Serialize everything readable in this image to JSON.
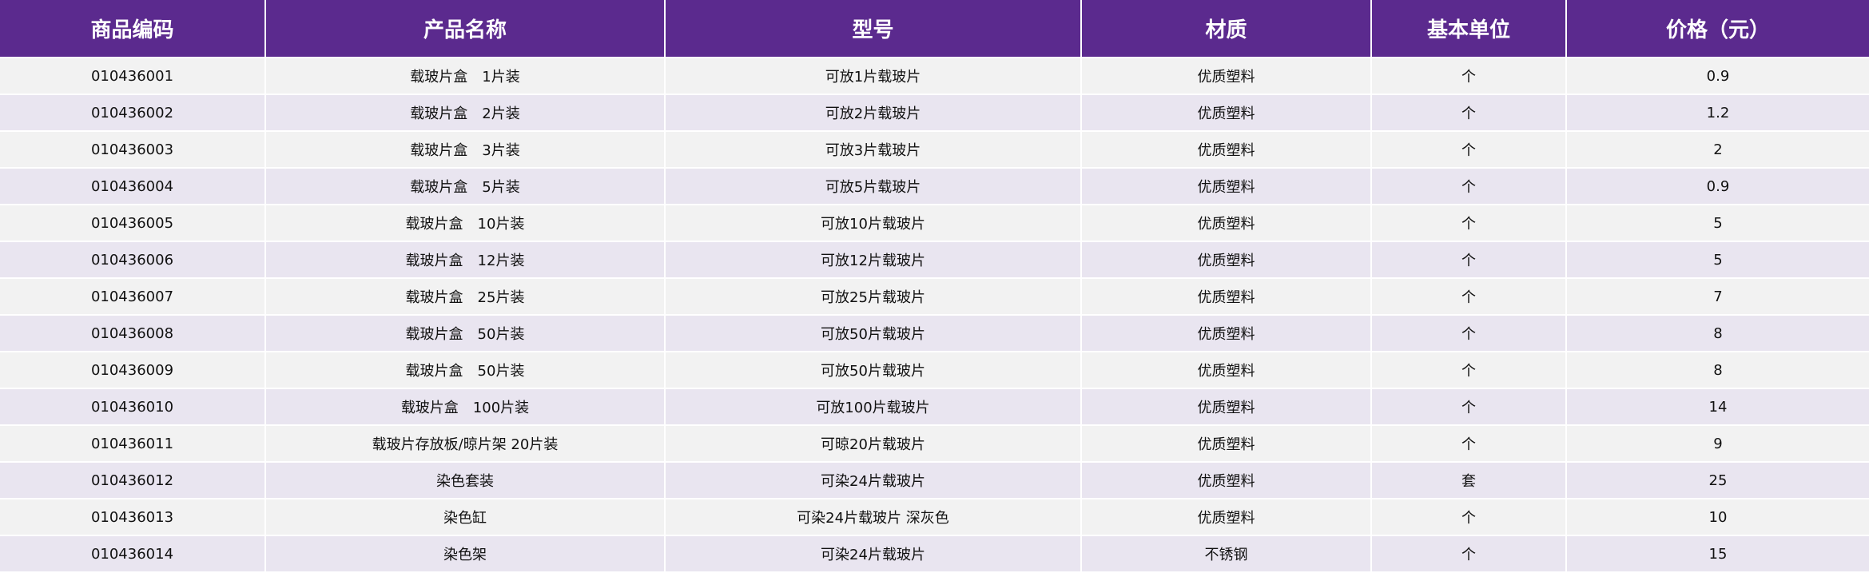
{
  "table": {
    "headers": [
      "商品编码",
      "产品名称",
      "型号",
      "材质",
      "基本单位",
      "价格（元）"
    ],
    "rows": [
      [
        "010436001",
        "载玻片盒　1片装",
        "可放1片载玻片",
        "优质塑料",
        "个",
        "0.9"
      ],
      [
        "010436002",
        "载玻片盒　2片装",
        "可放2片载玻片",
        "优质塑料",
        "个",
        "1.2"
      ],
      [
        "010436003",
        "载玻片盒　3片装",
        "可放3片载玻片",
        "优质塑料",
        "个",
        "2"
      ],
      [
        "010436004",
        "载玻片盒　5片装",
        "可放5片载玻片",
        "优质塑料",
        "个",
        "0.9"
      ],
      [
        "010436005",
        "载玻片盒　10片装",
        "可放10片载玻片",
        "优质塑料",
        "个",
        "5"
      ],
      [
        "010436006",
        "载玻片盒　12片装",
        "可放12片载玻片",
        "优质塑料",
        "个",
        "5"
      ],
      [
        "010436007",
        "载玻片盒　25片装",
        "可放25片载玻片",
        "优质塑料",
        "个",
        "7"
      ],
      [
        "010436008",
        "载玻片盒　50片装",
        "可放50片载玻片",
        "优质塑料",
        "个",
        "8"
      ],
      [
        "010436009",
        "载玻片盒　50片装",
        "可放50片载玻片",
        "优质塑料",
        "个",
        "8"
      ],
      [
        "010436010",
        "载玻片盒　100片装",
        "可放100片载玻片",
        "优质塑料",
        "个",
        "14"
      ],
      [
        "010436011",
        "载玻片存放板/晾片架 20片装",
        "可晾20片载玻片",
        "优质塑料",
        "个",
        "9"
      ],
      [
        "010436012",
        "染色套装",
        "可染24片载玻片",
        "优质塑料",
        "套",
        "25"
      ],
      [
        "010436013",
        "染色缸",
        "可染24片载玻片 深灰色",
        "优质塑料",
        "个",
        "10"
      ],
      [
        "010436014",
        "染色架",
        "可染24片载玻片",
        "不锈钢",
        "个",
        "15"
      ]
    ]
  },
  "colors": {
    "header_bg": "#5b2a8e",
    "row_odd_bg": "#f2f2f2",
    "row_even_bg": "#e9e5f0"
  }
}
